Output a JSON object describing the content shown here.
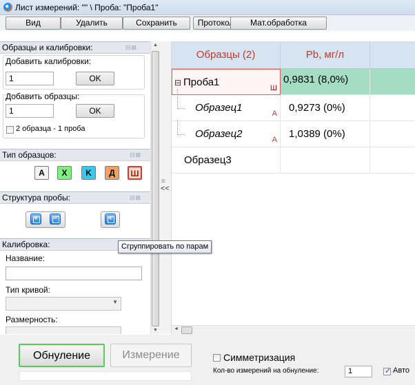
{
  "window": {
    "title": "Лист измерений: \"\" \\ Проба: \"Проба1\""
  },
  "toolbar": {
    "view": "Вид",
    "delete": "Удалить",
    "save": "Сохранить",
    "protocol": "Протокол",
    "math": "Мат.обработка"
  },
  "left_panel": {
    "samples_cal": {
      "header": "Образцы и калибровки:",
      "add_cal_label": "Добавить калибровки:",
      "add_cal_value": "1",
      "ok": "OK",
      "add_samples_label": "Добавить образцы:",
      "add_samples_value": "1",
      "pair_label": "2 образца - 1 проба"
    },
    "sample_types": {
      "header": "Тип образцов:",
      "buttons": [
        "A",
        "X",
        "K",
        "Д",
        "Ш"
      ]
    },
    "structure": {
      "header": "Структура пробы:"
    },
    "calibration": {
      "header": "Калибровка:",
      "name_label": "Название:",
      "curve_label": "Тип кривой:",
      "dimension_label": "Размерность:"
    }
  },
  "splitter": {
    "collapse": "<<",
    "grip": "≡"
  },
  "tooltip": "Сгруппировать по парам",
  "grid": {
    "columns": [
      "Образцы (2)",
      "Pb, мг/л"
    ],
    "rows": [
      {
        "name": "Проба1",
        "tag": "Ш",
        "value": "0,9831 (8,0%)"
      },
      {
        "name": "Образец1",
        "tag": "A",
        "value": "0,9273 (0%)"
      },
      {
        "name": "Образец2",
        "tag": "A",
        "value": "1,0389 (0%)"
      },
      {
        "name": "Образец3",
        "tag": "",
        "value": ""
      }
    ],
    "tree_toggle": "⊟"
  },
  "bottom": {
    "zero_btn": "Обнуление",
    "measure_btn": "Измерение",
    "symmetrize": "Симметризация",
    "zero_count_label": "Кол-во измерений на обнуление:",
    "zero_count_value": "1",
    "auto": "Авто"
  },
  "colors": {
    "accent_red": "#c0392b",
    "selected_row": "#a4dcc4",
    "green_border": "#5bc85b"
  }
}
